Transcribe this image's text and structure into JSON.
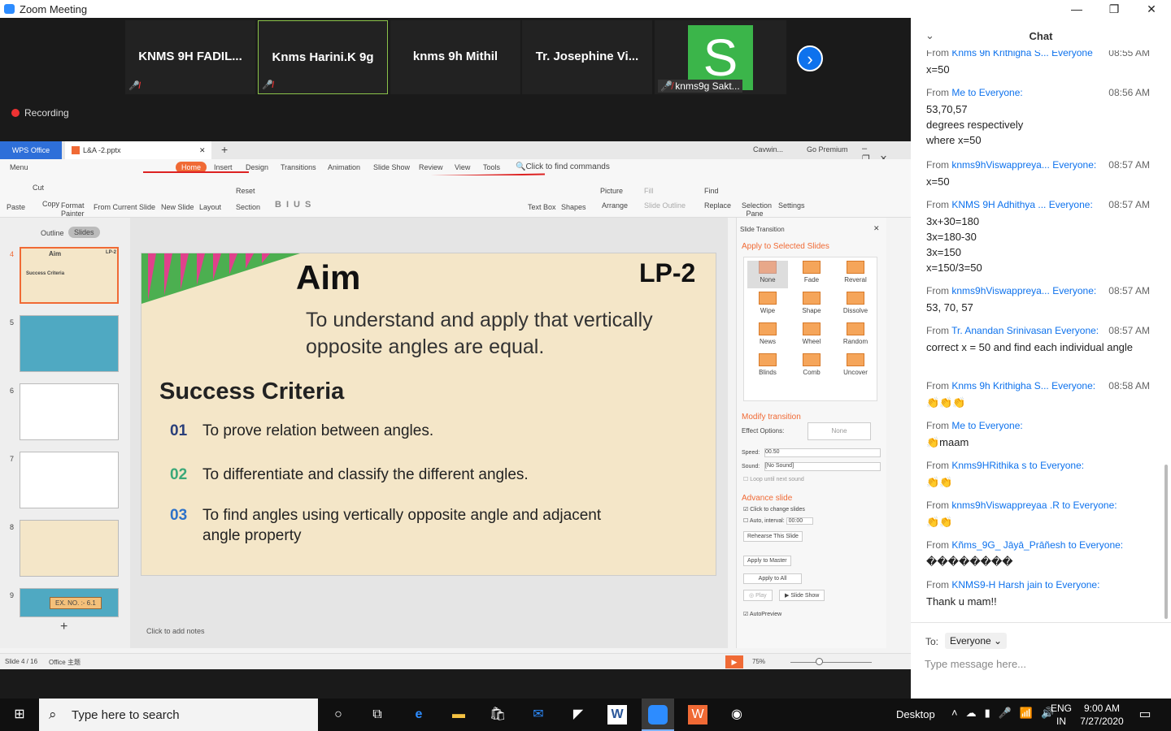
{
  "window": {
    "title": "Zoom Meeting"
  },
  "participants": [
    {
      "name": "KNMS 9H FADIL..."
    },
    {
      "name": "Knms Harini.K 9g"
    },
    {
      "name": "knms 9h Mithil"
    },
    {
      "name": "Tr. Josephine Vi..."
    },
    {
      "name": "knms9g Sakt...",
      "avatar_letter": "S"
    }
  ],
  "recording": "Recording",
  "wps": {
    "tabs": [
      "WPS Office",
      "L&A -2.pptx"
    ],
    "user": "Cavwin...",
    "premium": "Go Premium",
    "menu": [
      "Menu",
      "Home",
      "Insert",
      "Design",
      "Transitions",
      "Animation",
      "Slide Show",
      "Review",
      "View",
      "Tools"
    ],
    "find_commands": "Click to find commands",
    "ribbon": [
      "Paste",
      "Cut",
      "Copy",
      "Format Painter",
      "From Current Slide",
      "New Slide",
      "Layout",
      "Reset",
      "Section",
      "Text Box",
      "Shapes",
      "Picture",
      "Arrange",
      "Fill",
      "Slide Outline",
      "Find",
      "Replace",
      "Selection Pane",
      "Settings"
    ],
    "view_tabs": [
      "Outline",
      "Slides"
    ],
    "thumb_numbers": [
      "4",
      "5",
      "6",
      "7",
      "8",
      "9"
    ],
    "thumb_text": {
      "t4": "Aim",
      "t4b": "LP-2",
      "t4c": "Success Criteria",
      "t9": "EX. NO. :- 6.1"
    },
    "notes": "Click to add notes",
    "status": {
      "slide": "Slide 4 / 16",
      "theme": "Office 主题",
      "zoom": "75%"
    }
  },
  "slide": {
    "title": "Aim",
    "code": "LP-2",
    "aim_text": "To understand and apply that vertically opposite angles are equal.",
    "criteria_title": "Success Criteria",
    "criteria": [
      {
        "n": "01",
        "t": "To  prove relation between angles."
      },
      {
        "n": "02",
        "t": "To differentiate and classify the different angles."
      },
      {
        "n": "03",
        "t": "To find angles using vertically opposite angle and adjacent angle property"
      }
    ]
  },
  "transition_pane": {
    "title": "Slide Transition",
    "apply_selected": "Apply to Selected Slides",
    "effects": [
      "None",
      "Fade",
      "Reveral",
      "Wipe",
      "Shape",
      "Dissolve",
      "News",
      "Wheel",
      "Random",
      "Blinds",
      "Comb",
      "Uncover"
    ],
    "modify": "Modify transition",
    "effect_options": "Effect Options:",
    "effect_value": "None",
    "speed_label": "Speed:",
    "speed": "00.50",
    "sound_label": "Sound:",
    "sound": "[No Sound]",
    "loop": "Loop until next sound",
    "advance": "Advance slide",
    "click_change": "Click to change slides",
    "auto_interval": "Auto, interval:",
    "interval": "00:00",
    "rehearse": "Rehearse This Slide",
    "apply_master": "Apply to Master",
    "apply_all": "Apply to All",
    "play": "Play",
    "slideshow": "Slide Show",
    "autopreview": "AutoPreview"
  },
  "chat": {
    "title": "Chat",
    "messages": [
      {
        "from": "From Knms 9h Krithigha S...",
        "to": "Everyone",
        "time": "08:55 AM",
        "text": "x=50"
      },
      {
        "from": "From Me to",
        "to": "Everyone:",
        "time": "08:56 AM",
        "text": "53,70,57\ndegrees respectively\nwhere x=50"
      },
      {
        "from": "From knms9hViswappreya...",
        "to": "Everyone:",
        "time": "08:57 AM",
        "text": "x=50"
      },
      {
        "from": "From KNMS 9H Adhithya ...",
        "to": "Everyone:",
        "time": "08:57 AM",
        "text": "3x+30=180\n3x=180-30\n3x=150\nx=150/3=50"
      },
      {
        "from": "From knms9hViswappreya...",
        "to": "Everyone:",
        "time": "08:57 AM",
        "text": "53, 70, 57"
      },
      {
        "from": "From Tr. Anandan Srinivasan",
        "to": "Everyone:",
        "time": "08:57 AM",
        "text": "correct x = 50  and find each individual angle"
      },
      {
        "from": "From Knms 9h Krithigha S...",
        "to": "Everyone:",
        "time": "08:58 AM",
        "text": "👏👏👏"
      },
      {
        "from": "From Me to",
        "to": "Everyone:",
        "time": "",
        "text": "👏maam"
      },
      {
        "from": "From Knms9HRithika s to",
        "to": "Everyone:",
        "time": "",
        "text": "👏👏"
      },
      {
        "from": "From knms9hViswappreyaa .R to",
        "to": "Everyone:",
        "time": "",
        "text": "👏👏"
      },
      {
        "from": "From Kñms_9G_ Jāyā_Prāñesh to",
        "to": "Everyone:",
        "time": "",
        "text": "��������"
      },
      {
        "from": "From KNMS9-H  Harsh jain to",
        "to": "Everyone:",
        "time": "",
        "text": "Thank u mam!!"
      }
    ],
    "to_label": "To:",
    "to_value": "Everyone",
    "placeholder": "Type message here..."
  },
  "taskbar": {
    "search_placeholder": "Type here to search",
    "desktop": "Desktop",
    "lang1": "ENG",
    "lang2": "IN",
    "time": "9:00 AM",
    "date": "7/27/2020"
  },
  "colors": {
    "zoom_blue": "#2d8cff",
    "wps_orange": "#f06a35",
    "chat_link": "#0e72ed",
    "record_red": "#e33333"
  }
}
